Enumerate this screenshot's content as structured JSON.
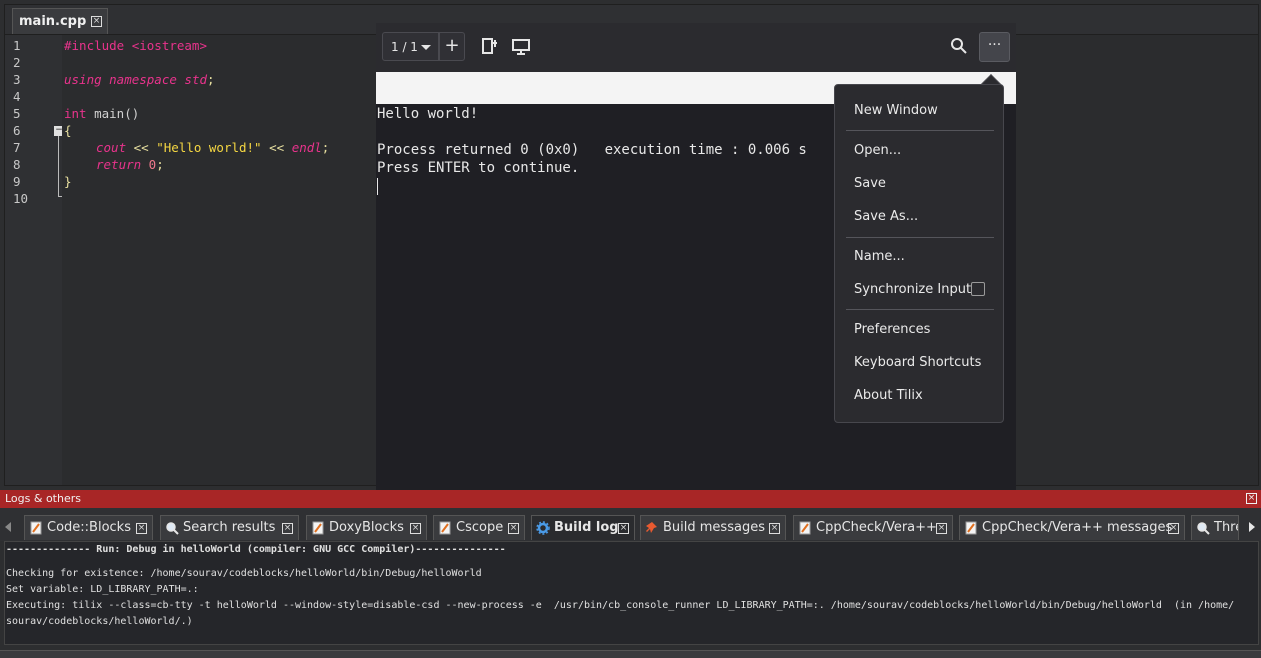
{
  "editor": {
    "tab_label": "main.cpp",
    "tab_close": "×",
    "line_numbers": [
      "1",
      "2",
      "3",
      "4",
      "5",
      "6",
      "7",
      "8",
      "9",
      "10"
    ],
    "fold_symbol": "−",
    "code": {
      "l1": "#include <iostream>",
      "l3_kw": "using namespace",
      "l3_id": " std",
      "l3_end": ";",
      "l5_type": "int",
      "l5_rest": " main()",
      "l6": "{",
      "l7_id": "cout",
      "l7_op1": " << ",
      "l7_str": "\"Hello world!\"",
      "l7_op2": " << ",
      "l7_endl": "endl",
      "l7_end": ";",
      "l8_kw": "return",
      "l8_num": " 0",
      "l8_end": ";",
      "l9": "}"
    }
  },
  "terminal": {
    "session_label": "1 / 1",
    "add_label": "+",
    "menu_button_label": "···",
    "output": [
      "Hello world!",
      "",
      "Process returned 0 (0x0)   execution time : 0.006 s",
      "Press ENTER to continue."
    ],
    "icons": [
      "new-terminal-icon",
      "sidebar-icon",
      "search-icon",
      "hamburger-icon"
    ]
  },
  "menu": {
    "items": [
      "New Window",
      "Open...",
      "Save",
      "Save As...",
      "Name...",
      "Synchronize Input",
      "Preferences",
      "Keyboard Shortcuts",
      "About Tilix"
    ]
  },
  "logs": {
    "title": "Logs & others",
    "close": "×",
    "tabs": [
      {
        "label": "Code::Blocks",
        "icon": "note-icon"
      },
      {
        "label": "Search results",
        "icon": "search-icon"
      },
      {
        "label": "DoxyBlocks",
        "icon": "note-icon"
      },
      {
        "label": "Cscope",
        "icon": "note-icon"
      },
      {
        "label": "Build log",
        "icon": "gear-icon"
      },
      {
        "label": "Build messages",
        "icon": "pin-icon"
      },
      {
        "label": "CppCheck/Vera++",
        "icon": "note-icon"
      },
      {
        "label": "CppCheck/Vera++ messages",
        "icon": "note-icon"
      },
      {
        "label": "Thre",
        "icon": "search-icon"
      }
    ],
    "lines": [
      "-------------- Run: Debug in helloWorld (compiler: GNU GCC Compiler)---------------",
      "",
      "Checking for existence: /home/sourav/codeblocks/helloWorld/bin/Debug/helloWorld",
      "Set variable: LD_LIBRARY_PATH=.:",
      "Executing: tilix --class=cb-tty -t helloWorld --window-style=disable-csd --new-process -e  /usr/bin/cb_console_runner LD_LIBRARY_PATH=:. /home/sourav/codeblocks/helloWorld/bin/Debug/helloWorld  (in /home/",
      "sourav/codeblocks/helloWorld/.)"
    ]
  },
  "colors": {
    "logs_title_bg": "#a82626",
    "keyword": "#e8338c",
    "string": "#f5d742"
  }
}
